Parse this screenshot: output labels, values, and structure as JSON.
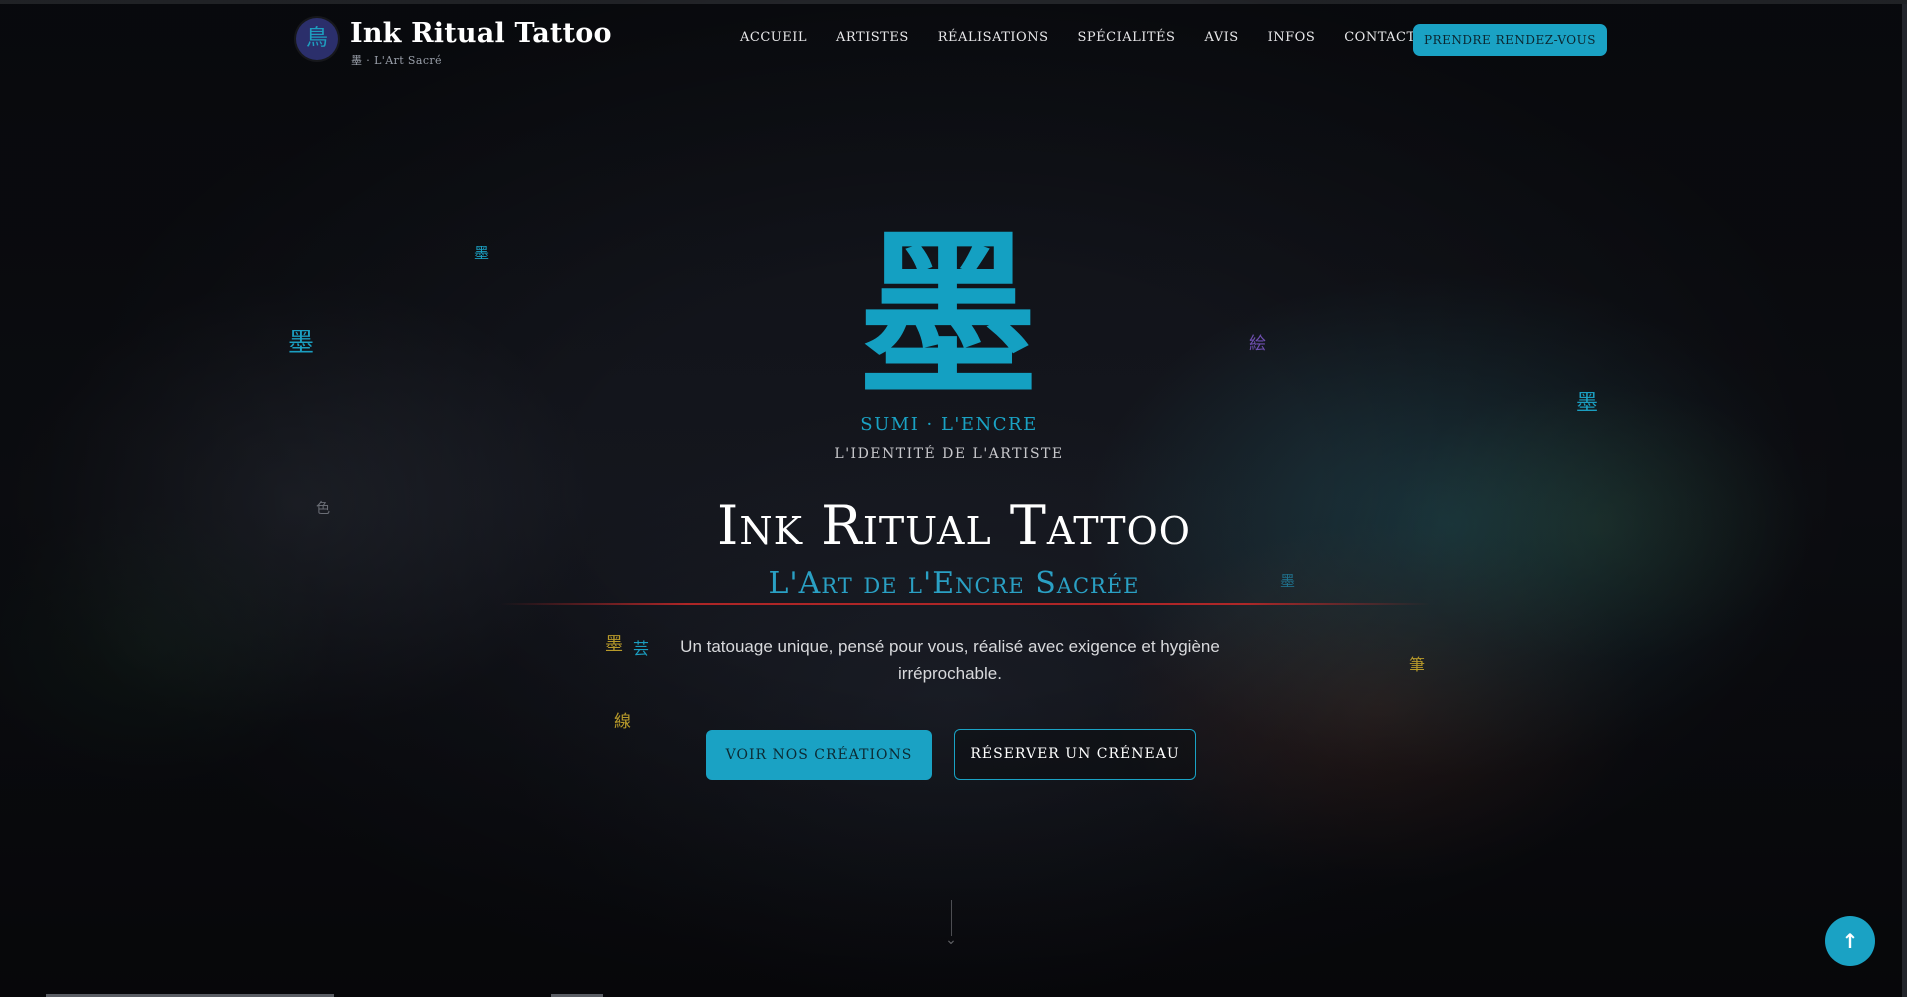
{
  "nav": {
    "logo_glyph": "鳥",
    "brand_name": "Ink Ritual Tattoo",
    "brand_tagline": "墨 · L'Art Sacré",
    "menu": [
      {
        "label": "ACCUEIL"
      },
      {
        "label": "ARTISTES"
      },
      {
        "label": "RÉALISATIONS"
      },
      {
        "label": "SPÉCIALITÉS"
      },
      {
        "label": "AVIS"
      },
      {
        "label": "INFOS"
      },
      {
        "label": "CONTACT"
      }
    ],
    "cta_label": "PRENDRE RENDEZ-VOUS"
  },
  "hero": {
    "kanji": "墨",
    "kanji_caption": "SUMI · L'ENCRE",
    "kanji_subcaption": "L'IDENTITÉ DE L'ARTISTE",
    "title": "Ink Ritual Tattoo",
    "subtitle": "L'Art de l'Encre Sacrée",
    "description": "Un tatouage unique, pensé pour vous, réalisé avec exigence et hygiène irréprochable.",
    "primary_button": "VOIR NOS CRÉATIONS",
    "secondary_button": "RÉSERVER UN CRÉNEAU"
  },
  "floating_kanji": [
    {
      "char": "墨",
      "color": "#1b9ec0"
    },
    {
      "char": "墨",
      "color": "#1b9ec0"
    },
    {
      "char": "色",
      "color": "#6a6d75"
    },
    {
      "char": "墨",
      "color": "#b89a2a"
    },
    {
      "char": "芸",
      "color": "#1b9ec0"
    },
    {
      "char": "線",
      "color": "#b89a2a"
    },
    {
      "char": "絵",
      "color": "#6f4fb0"
    },
    {
      "char": "墨",
      "color": "#1b9ec0"
    },
    {
      "char": "墨",
      "color": "#1f6f8a"
    },
    {
      "char": "筆",
      "color": "#b89a2a"
    }
  ],
  "icons": {
    "scroll_hint": "chevron-down-icon",
    "back_to_top": "arrow-up-icon"
  },
  "colors": {
    "accent": "#1aa2c4",
    "rule": "#c82828",
    "background": "#0d0f14"
  }
}
